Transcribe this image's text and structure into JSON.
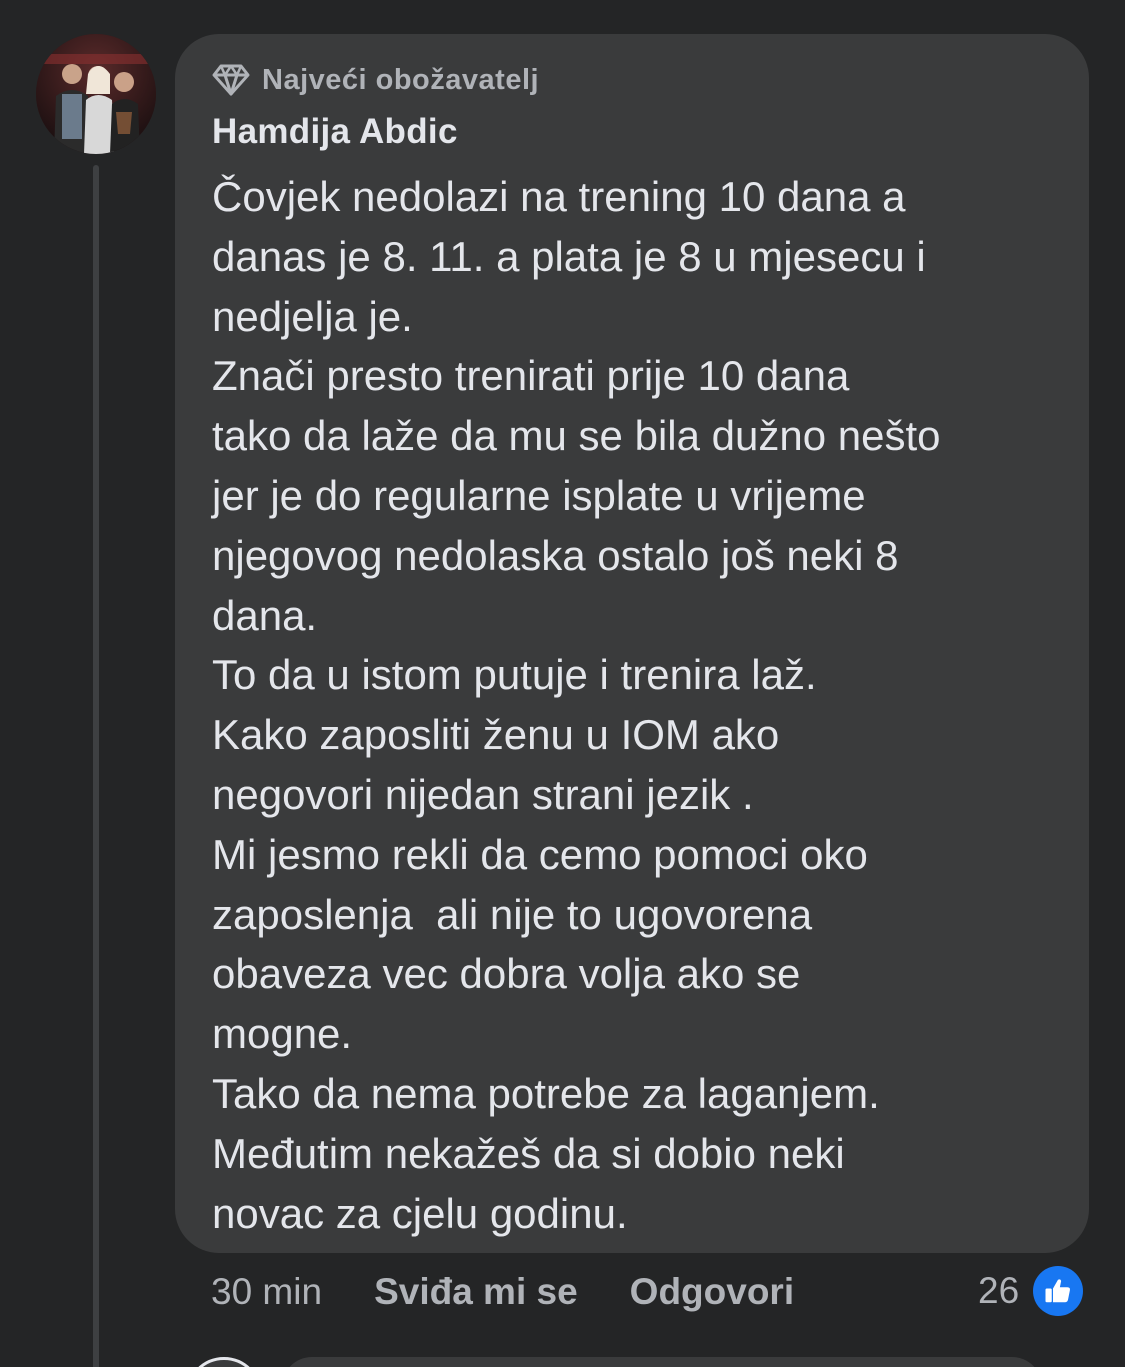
{
  "comment": {
    "badge_label": "Najveći obožavatelj",
    "author": "Hamdija Abdic",
    "text": "Čovjek nedolazi na trening 10 dana a\ndanas je 8. 11. a plata je 8 u mjesecu i\nnedjelja je.\nZnači presto trenirati prije 10 dana\ntako da laže da mu se bila dužno nešto\njer je do regularne isplate u vrijeme\nnjegovog nedolaska ostalo još neki 8\ndana.\nTo da u istom putuje i trenira laž.\nKako zaposliti ženu u IOM ako\nnegovori nijedan strani jezik .\nMi jesmo rekli da cemo pomoci oko\nzaposlenja  ali nije to ugovorena\nobaveza vec dobra volja ako se\nmogne.\nTako da nema potrebe za laganjem.\nMeđutim nekažeš da si dobio neki\nnovac za cjelu godinu.",
    "timestamp": "30 min",
    "like_label": "Sviđa mi se",
    "reply_label": "Odgovori",
    "reaction_count": "26"
  },
  "icons": {
    "badge": "diamond-icon",
    "reaction": "thumbs-up-icon",
    "avatar": "avatar"
  },
  "colors": {
    "background": "#242526",
    "bubble": "#3a3b3c",
    "primary_text": "#e4e6eb",
    "secondary_text": "#b0b3b8",
    "like_blue": "#1877f2"
  }
}
